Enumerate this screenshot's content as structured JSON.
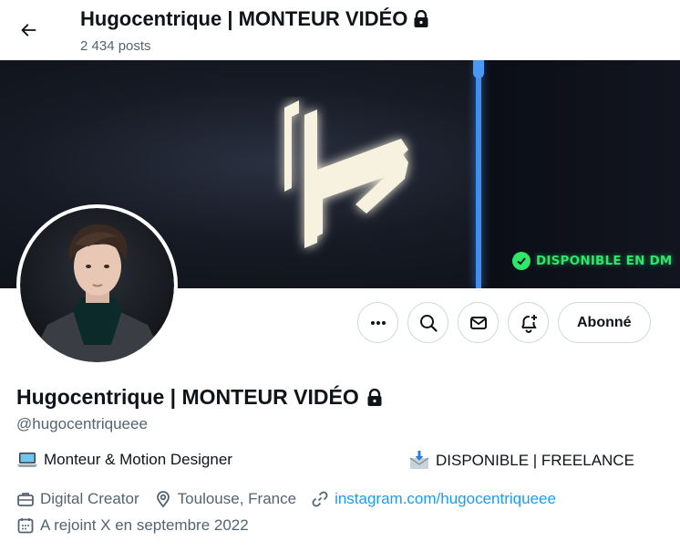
{
  "header": {
    "title": "Hugocentrique | MONTEUR VIDÉO",
    "posts_count": "2 434 posts",
    "back_icon": "arrow-left-icon"
  },
  "banner": {
    "badge_text": "DISPONIBLE EN DM",
    "accent_line_color": "#3f8ef0",
    "badge_color": "#2ee66a"
  },
  "actions": {
    "more_icon": "more-horizontal-icon",
    "search_icon": "search-icon",
    "message_icon": "envelope-icon",
    "notify_icon": "bell-plus-icon",
    "follow_label": "Abonné"
  },
  "profile": {
    "name": "Hugocentrique | MONTEUR VIDÉO",
    "handle": "@hugocentriqueee",
    "bio_left": "Monteur & Motion Designer",
    "bio_right": "DISPONIBLE | FREELANCE",
    "category": "Digital Creator",
    "location": "Toulouse, France",
    "website": "instagram.com/hugocentriqueee",
    "joined": "A rejoint X en septembre 2022",
    "link_color": "#1d9bf0"
  }
}
